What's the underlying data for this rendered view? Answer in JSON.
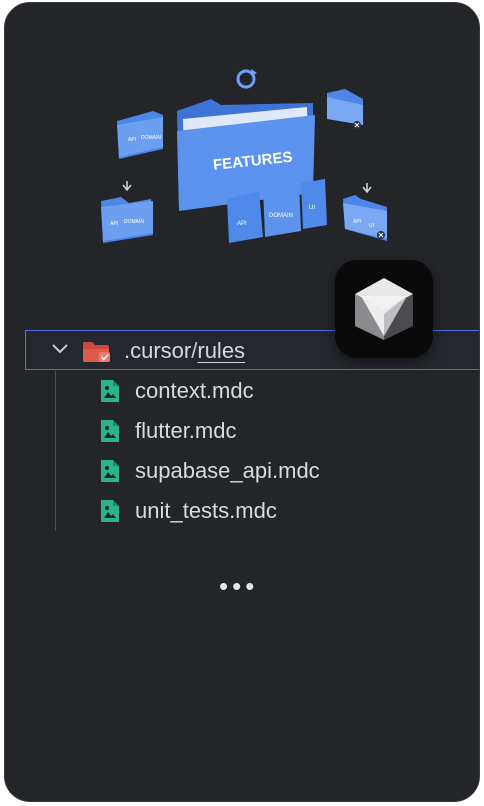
{
  "illustration": {
    "main_folder_label": "FEATURES",
    "sub_labels": [
      "API",
      "DOMAIN",
      "UI"
    ],
    "small_folder_labels": [
      "API",
      "DOMAIN"
    ],
    "small_folder_labels_2": [
      "API",
      "UI"
    ]
  },
  "tree": {
    "folder_prefix": ".cursor",
    "folder_separator": "/",
    "folder_suffix": "rules",
    "files": [
      {
        "name": "context.mdc"
      },
      {
        "name": "flutter.mdc"
      },
      {
        "name": "supabase_api.mdc"
      },
      {
        "name": "unit_tests.mdc"
      }
    ]
  },
  "more_indicator": "•••",
  "colors": {
    "background": "#232529",
    "accent_border": "#4f6fe0",
    "folder_icon": "#e05a4c",
    "file_icon": "#2bb38a",
    "illustration_blue": "#4b86e8"
  },
  "icons": {
    "chevron": "chevron-down-icon",
    "folder": "folder-icon",
    "file": "file-icon",
    "logo": "cursor-logo-icon"
  }
}
